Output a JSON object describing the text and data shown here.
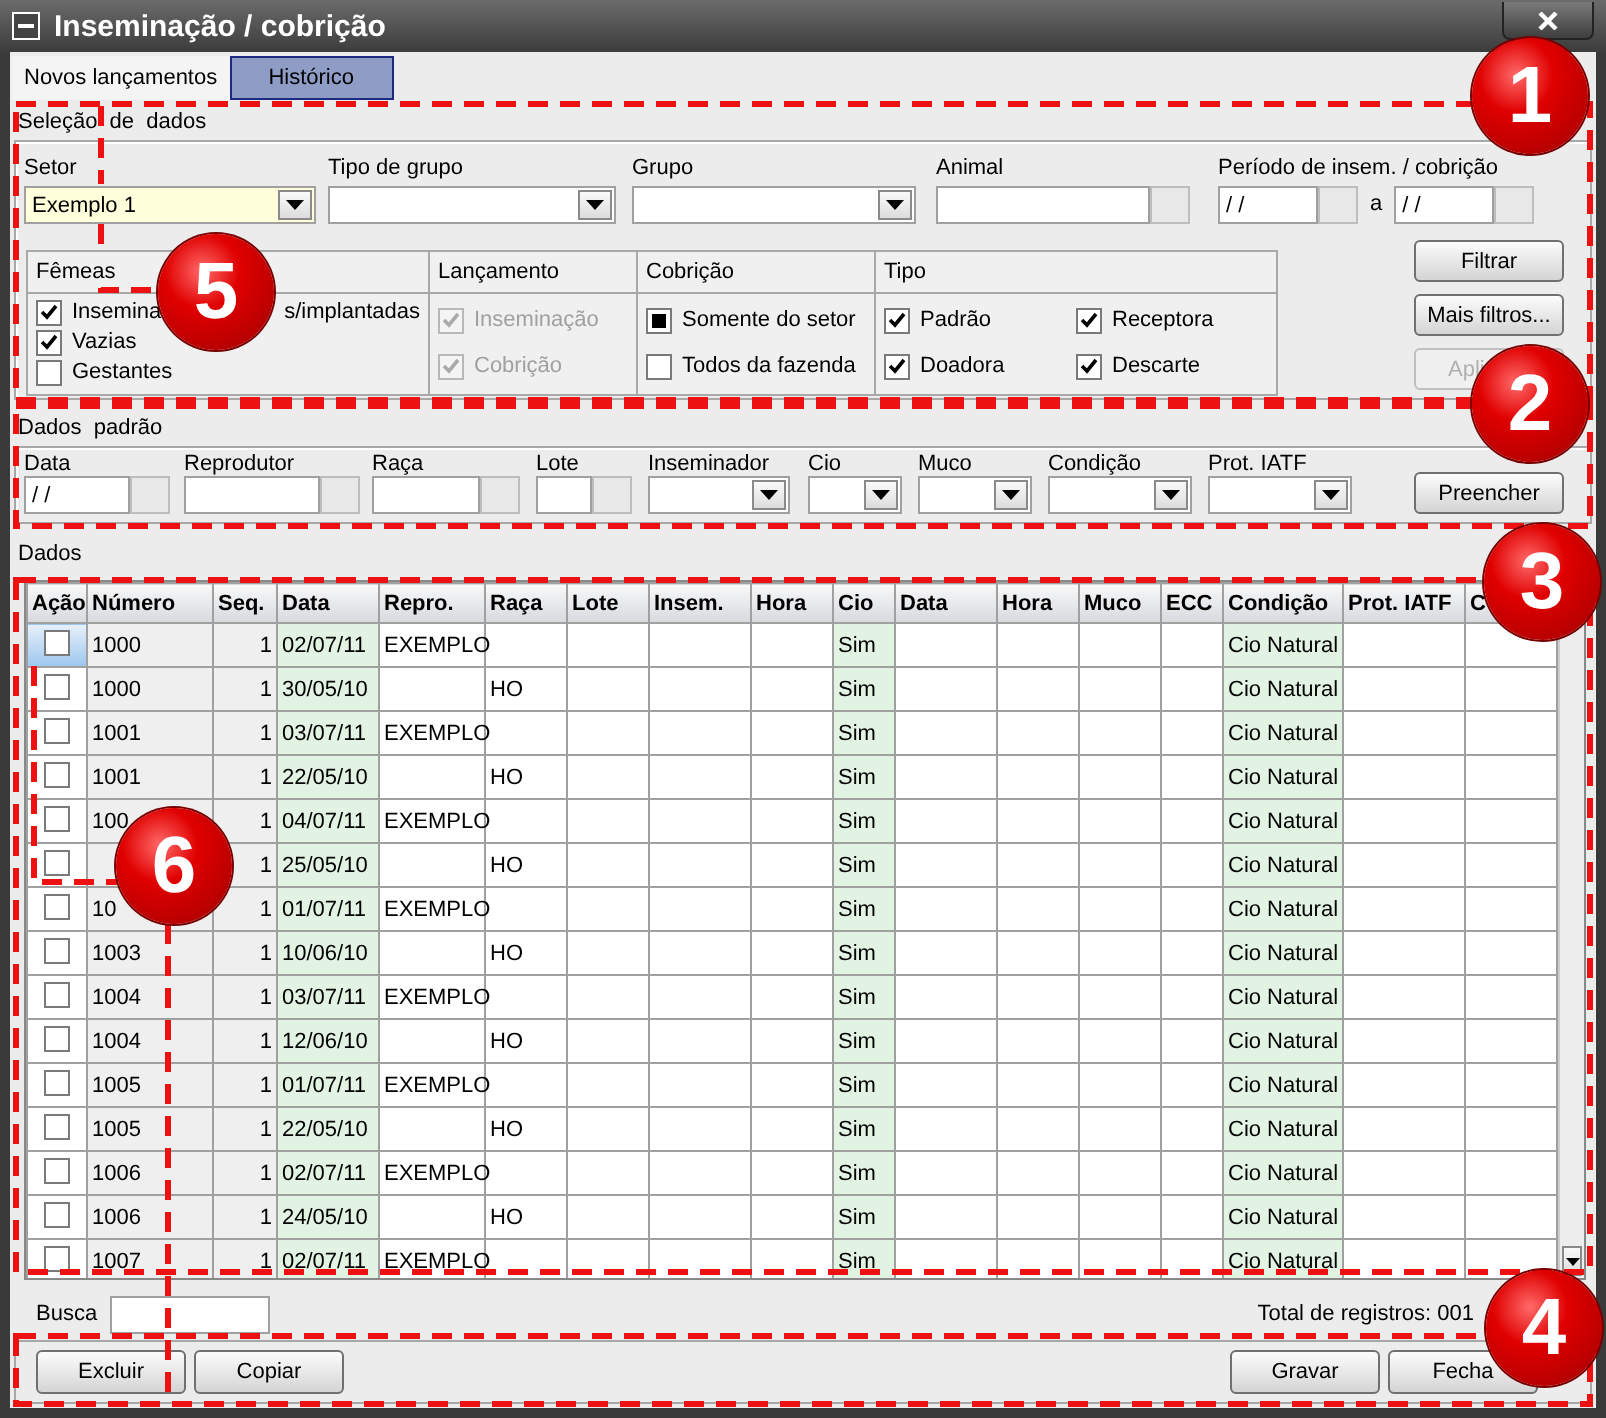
{
  "window": {
    "title": "Inseminação / cobrição"
  },
  "tabs": [
    {
      "label": "Novos lançamentos",
      "selected": true
    },
    {
      "label": "Histórico",
      "selected": false
    }
  ],
  "selection": {
    "title": "Seleção de dados",
    "fields": [
      {
        "label": "Setor",
        "kind": "dropdown",
        "value": "Exemplo 1",
        "highlighted": true
      },
      {
        "label": "Tipo de grupo",
        "kind": "dropdown",
        "highlighted": false
      },
      {
        "label": "Grupo",
        "kind": "dropdown",
        "highlighted": false
      },
      {
        "label": "Animal",
        "kind": "lookup"
      }
    ],
    "period": {
      "label": "Período de insem. / cobrição",
      "from": "/ /",
      "separator": "a",
      "to": "/ /"
    },
    "filters": [
      {
        "title": "Fêmeas",
        "options": [
          {
            "kind": "check",
            "label": "Insemina",
            "label_after": "s/implantadas",
            "checked": true,
            "disabled": false
          },
          {
            "kind": "check",
            "label": "Vazias",
            "checked": true,
            "disabled": false
          },
          {
            "kind": "check",
            "label": "Gestantes",
            "checked": false,
            "disabled": false
          }
        ]
      },
      {
        "title": "Lançamento",
        "options": [
          {
            "kind": "check",
            "label": "Inseminação",
            "checked": true,
            "disabled": true
          },
          {
            "kind": "check",
            "label": "Cobrição",
            "checked": true,
            "disabled": true
          }
        ]
      },
      {
        "title": "Cobrição",
        "options": [
          {
            "kind": "radio",
            "label": "Somente do setor",
            "selected": true
          },
          {
            "kind": "radio",
            "label": "Todos da fazenda",
            "selected": false
          }
        ]
      },
      {
        "title": "Tipo",
        "options": [
          {
            "kind": "check",
            "label": "Padrão",
            "checked": true,
            "disabled": false
          },
          {
            "kind": "check",
            "label": "Receptora",
            "checked": true,
            "disabled": false
          },
          {
            "kind": "check",
            "label": "Doadora",
            "checked": true,
            "disabled": false
          },
          {
            "kind": "check",
            "label": "Descarte",
            "checked": true,
            "disabled": false
          }
        ]
      }
    ],
    "buttons": [
      {
        "label": "Filtrar",
        "disabled": false
      },
      {
        "label": "Mais filtros...",
        "disabled": false
      },
      {
        "label": "Apli",
        "disabled": true
      }
    ]
  },
  "defaults": {
    "title": "Dados padrão",
    "fields": [
      {
        "label": "Data",
        "kind": "lookup",
        "value": "/ /"
      },
      {
        "label": "Reprodutor",
        "kind": "lookup"
      },
      {
        "label": "Raça",
        "kind": "lookup"
      },
      {
        "label": "Lote",
        "kind": "lookup"
      },
      {
        "label": "Inseminador",
        "kind": "dropdown"
      },
      {
        "label": "Cio",
        "kind": "dropdown"
      },
      {
        "label": "Muco",
        "kind": "dropdown"
      },
      {
        "label": "Condição",
        "kind": "dropdown"
      },
      {
        "label": "Prot. IATF",
        "kind": "dropdown"
      }
    ],
    "button": "Preencher"
  },
  "data_title": "Dados",
  "table": {
    "columns": [
      {
        "label": "Ação",
        "kind": "check"
      },
      {
        "label": "Número",
        "kind": "key"
      },
      {
        "label": "Seq.",
        "kind": "count"
      },
      {
        "label": "Data",
        "kind": "highlight"
      },
      {
        "label": "Repro.",
        "kind": "plain"
      },
      {
        "label": "Raça",
        "kind": "plain"
      },
      {
        "label": "Lote",
        "kind": "plain"
      },
      {
        "label": "Insem.",
        "kind": "plain"
      },
      {
        "label": "Hora",
        "kind": "plain"
      },
      {
        "label": "Cio",
        "kind": "highlight"
      },
      {
        "label": "Data",
        "kind": "plain"
      },
      {
        "label": "Hora",
        "kind": "plain"
      },
      {
        "label": "Muco",
        "kind": "plain"
      },
      {
        "label": "ECC",
        "kind": "plain"
      },
      {
        "label": "Condição",
        "kind": "highlight"
      },
      {
        "label": "Prot. IATF",
        "kind": "plain"
      },
      {
        "label": "C",
        "kind": "plain"
      }
    ],
    "rows": [
      {
        "selected": true,
        "checked": false,
        "cells": [
          null,
          "1000",
          "1",
          "02/07/11",
          "EXEMPLO",
          null,
          null,
          null,
          null,
          "Sim",
          null,
          null,
          null,
          null,
          "Cio Natural",
          null,
          null
        ]
      },
      {
        "selected": false,
        "checked": false,
        "cells": [
          null,
          "1000",
          "1",
          "30/05/10",
          null,
          "HO",
          null,
          null,
          null,
          "Sim",
          null,
          null,
          null,
          null,
          "Cio Natural",
          null,
          null
        ]
      },
      {
        "selected": false,
        "checked": false,
        "cells": [
          null,
          "1001",
          "1",
          "03/07/11",
          "EXEMPLO",
          null,
          null,
          null,
          null,
          "Sim",
          null,
          null,
          null,
          null,
          "Cio Natural",
          null,
          null
        ]
      },
      {
        "selected": false,
        "checked": false,
        "cells": [
          null,
          "1001",
          "1",
          "22/05/10",
          null,
          "HO",
          null,
          null,
          null,
          "Sim",
          null,
          null,
          null,
          null,
          "Cio Natural",
          null,
          null
        ]
      },
      {
        "selected": false,
        "checked": false,
        "cells": [
          null,
          "100",
          "1",
          "04/07/11",
          "EXEMPLO",
          null,
          null,
          null,
          null,
          "Sim",
          null,
          null,
          null,
          null,
          "Cio Natural",
          null,
          null
        ]
      },
      {
        "selected": false,
        "checked": false,
        "cells": [
          null,
          null,
          "1",
          "25/05/10",
          null,
          "HO",
          null,
          null,
          null,
          "Sim",
          null,
          null,
          null,
          null,
          "Cio Natural",
          null,
          null
        ]
      },
      {
        "selected": false,
        "checked": false,
        "cells": [
          null,
          "10",
          "1",
          "01/07/11",
          "EXEMPLO",
          null,
          null,
          null,
          null,
          "Sim",
          null,
          null,
          null,
          null,
          "Cio Natural",
          null,
          null
        ]
      },
      {
        "selected": false,
        "checked": false,
        "cells": [
          null,
          "1003",
          "1",
          "10/06/10",
          null,
          "HO",
          null,
          null,
          null,
          "Sim",
          null,
          null,
          null,
          null,
          "Cio Natural",
          null,
          null
        ]
      },
      {
        "selected": false,
        "checked": false,
        "cells": [
          null,
          "1004",
          "1",
          "03/07/11",
          "EXEMPLO",
          null,
          null,
          null,
          null,
          "Sim",
          null,
          null,
          null,
          null,
          "Cio Natural",
          null,
          null
        ]
      },
      {
        "selected": false,
        "checked": false,
        "cells": [
          null,
          "1004",
          "1",
          "12/06/10",
          null,
          "HO",
          null,
          null,
          null,
          "Sim",
          null,
          null,
          null,
          null,
          "Cio Natural",
          null,
          null
        ]
      },
      {
        "selected": false,
        "checked": false,
        "cells": [
          null,
          "1005",
          "1",
          "01/07/11",
          "EXEMPLO",
          null,
          null,
          null,
          null,
          "Sim",
          null,
          null,
          null,
          null,
          "Cio Natural",
          null,
          null
        ]
      },
      {
        "selected": false,
        "checked": false,
        "cells": [
          null,
          "1005",
          "1",
          "22/05/10",
          null,
          "HO",
          null,
          null,
          null,
          "Sim",
          null,
          null,
          null,
          null,
          "Cio Natural",
          null,
          null
        ]
      },
      {
        "selected": false,
        "checked": false,
        "cells": [
          null,
          "1006",
          "1",
          "02/07/11",
          "EXEMPLO",
          null,
          null,
          null,
          null,
          "Sim",
          null,
          null,
          null,
          null,
          "Cio Natural",
          null,
          null
        ]
      },
      {
        "selected": false,
        "checked": false,
        "cells": [
          null,
          "1006",
          "1",
          "24/05/10",
          null,
          "HO",
          null,
          null,
          null,
          "Sim",
          null,
          null,
          null,
          null,
          "Cio Natural",
          null,
          null
        ]
      },
      {
        "selected": false,
        "checked": false,
        "cells": [
          null,
          "1007",
          "1",
          "02/07/11",
          "EXEMPLO",
          null,
          null,
          null,
          null,
          "Sim",
          null,
          null,
          null,
          null,
          "Cio Natural",
          null,
          null
        ]
      }
    ]
  },
  "footer": {
    "search_label": "Busca",
    "total": "Total de registros: 001"
  },
  "actions": {
    "left": [
      "Excluir",
      "Copiar"
    ],
    "right": [
      "Gravar",
      "Fecha"
    ]
  },
  "annotations": [
    {
      "number": "1"
    },
    {
      "number": "2"
    },
    {
      "number": "3"
    },
    {
      "number": "4"
    },
    {
      "number": "5"
    },
    {
      "number": "6"
    }
  ]
}
